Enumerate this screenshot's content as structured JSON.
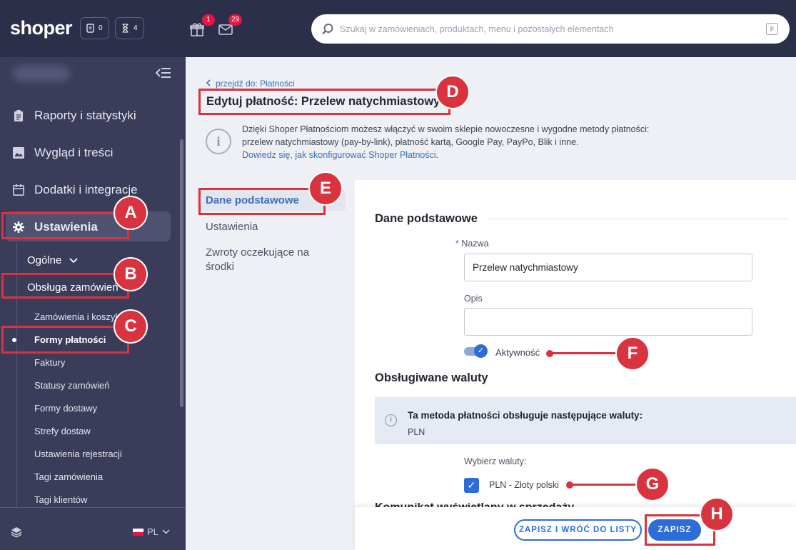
{
  "topbar": {
    "logo": "shoper",
    "orders_count": "0",
    "tasks_count": "4",
    "gift_badge": "1",
    "mail_badge": "29",
    "search_placeholder": "Szukaj w zamówieniach, produktach, menu i pozostałych elementach",
    "search_shortcut": "F"
  },
  "sidebar": {
    "items": [
      {
        "label": "Raporty i statystyki",
        "icon": "clipboard-icon"
      },
      {
        "label": "Wygląd i treści",
        "icon": "image-icon"
      },
      {
        "label": "Dodatki i integracje",
        "icon": "calendar-icon"
      },
      {
        "label": "Ustawienia",
        "icon": "gear-icon"
      }
    ],
    "sub": {
      "general": "Ogólne",
      "orders": "Obsługa zamówień"
    },
    "subsub": [
      "Zamówienia i koszyk",
      "Formy płatności",
      "Faktury",
      "Statusy zamówień",
      "Formy dostawy",
      "Strefy dostaw",
      "Ustawienia rejestracji",
      "Tagi zamówienia",
      "Tagi klientów"
    ],
    "lang": "PL"
  },
  "page": {
    "back_link": "przejdź do: Płatności",
    "title": "Edytuj płatność: Przelew natychmiastowy",
    "info_line1": "Dzięki Shoper Płatnościom możesz włączyć w swoim sklepie nowoczesne i wygodne metody płatności:",
    "info_line2": "przelew natychmiastowy (pay-by-link), płatność kartą, Google Pay, PayPo, Blik i inne.",
    "info_link": "Dowiedz się, jak skonfigurować Shoper Płatności",
    "info_link_end": "."
  },
  "tabs": [
    "Dane podstawowe",
    "Ustawienia",
    "Zwroty oczekujące na środki"
  ],
  "form": {
    "section_basic": "Dane podstawowe",
    "name_req": "*",
    "name_label": "Nazwa",
    "name_value": "Przelew natychmiastowy",
    "desc_label": "Opis",
    "desc_value": "",
    "active_label": "Aktywność",
    "section_currencies": "Obsługiwane waluty",
    "currency_info_title": "Ta metoda płatności obsługuje następujące waluty:",
    "currency_info_value": "PLN",
    "choose_currency_label": "Wybierz waluty:",
    "currency_option": "PLN - Złoty polski",
    "cut_heading": "Komunikat wyświetlany w sprzedaży"
  },
  "footer": {
    "save_back": "ZAPISZ I WRÓĆ DO LISTY",
    "save": "ZAPISZ"
  },
  "markers": [
    "A",
    "B",
    "C",
    "D",
    "E",
    "F",
    "G",
    "H"
  ],
  "colors": {
    "highlight": "#d8333f",
    "primary": "#2e6dd8",
    "sidebar": "#3a3c5a",
    "topbar": "#2c2f4a"
  }
}
